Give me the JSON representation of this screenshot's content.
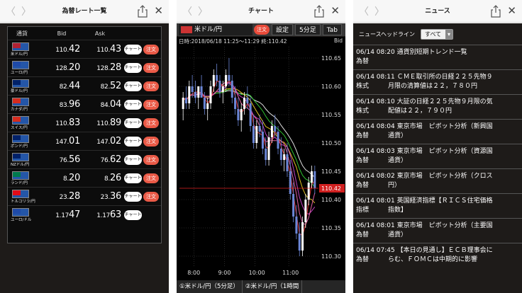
{
  "rates_screen": {
    "title": "為替レート一覧",
    "headers": {
      "currency": "通貨",
      "bid": "Bid",
      "ask": "Ask"
    },
    "chart_label": "チャート",
    "order_label": "注文",
    "rows": [
      {
        "pair": "米ドル/円",
        "bid_main": "110.",
        "bid_big": "42",
        "ask_main": "110.",
        "ask_big": "43",
        "has_order": true,
        "flag": "#b22234"
      },
      {
        "pair": "ユーロ/円",
        "bid_main": "128.",
        "bid_big": "20",
        "ask_main": "128.",
        "ask_big": "28",
        "has_order": true,
        "flag": "#1f4aa8"
      },
      {
        "pair": "豪ドル/円",
        "bid_main": "82.",
        "bid_big": "44",
        "ask_main": "82.",
        "ask_big": "52",
        "has_order": true,
        "flag": "#012169"
      },
      {
        "pair": "カナダ/円",
        "bid_main": "83.",
        "bid_big": "96",
        "ask_main": "84.",
        "ask_big": "04",
        "has_order": true,
        "flag": "#d52b1e"
      },
      {
        "pair": "スイス/円",
        "bid_main": "110.",
        "bid_big": "83",
        "ask_main": "110.",
        "ask_big": "89",
        "has_order": true,
        "flag": "#d52b1e"
      },
      {
        "pair": "ポンド/円",
        "bid_main": "147.",
        "bid_big": "01",
        "ask_main": "147.",
        "ask_big": "02",
        "has_order": true,
        "flag": "#012169"
      },
      {
        "pair": "NZドル/円",
        "bid_main": "76.",
        "bid_big": "56",
        "ask_main": "76.",
        "ask_big": "62",
        "has_order": true,
        "flag": "#012169"
      },
      {
        "pair": "ランド/円",
        "bid_main": "8.",
        "bid_big": "20",
        "ask_main": "8.",
        "ask_big": "26",
        "has_order": true,
        "flag": "#007a4d"
      },
      {
        "pair": "トルコリラ/円",
        "bid_main": "23.",
        "bid_big": "28",
        "ask_main": "23.",
        "ask_big": "36",
        "has_order": true,
        "flag": "#e30a17"
      },
      {
        "pair": "ユーロ/ドル",
        "bid_main": "1.17",
        "bid_big": "47",
        "ask_main": "1.17",
        "ask_big": "63",
        "has_order": false,
        "flag": "#1f4aa8"
      }
    ]
  },
  "chart_screen": {
    "title": "チャート",
    "pair": "米ドル/円",
    "order_label": "注文",
    "settings_label": "設定",
    "timeframe_label": "5分足",
    "tab_label": "Tab",
    "info": "日時:2018/06/18 11:25～11:29 終:110.42",
    "bid_label": "Bid",
    "current_price_label": "110.42",
    "tabs": [
      "①米ドル/円（5分足）",
      "②米ドル/円（1時間"
    ],
    "colors": {
      "up": "#ffffff",
      "down": "#6b86d6",
      "ma_short": "#e03030",
      "ma_mid": "#c040c0",
      "ma_long": "#dddddd",
      "ma_green": "#30c030",
      "ma_yellow": "#e0c020",
      "ma_pink": "#e060a0"
    }
  },
  "chart_data": {
    "type": "candlestick",
    "x_tick_labels": [
      "8:00",
      "9:00",
      "10:00",
      "11:00"
    ],
    "y_tick_labels": [
      "110.65",
      "110.60",
      "110.55",
      "110.50",
      "110.45",
      "110.40",
      "110.35",
      "110.30"
    ],
    "ylim": [
      110.28,
      110.67
    ],
    "current_price": 110.42,
    "candles": [
      [
        110.56,
        110.59,
        110.54,
        110.58
      ],
      [
        110.58,
        110.6,
        110.56,
        110.57
      ],
      [
        110.57,
        110.61,
        110.56,
        110.6
      ],
      [
        110.6,
        110.62,
        110.58,
        110.59
      ],
      [
        110.59,
        110.61,
        110.57,
        110.58
      ],
      [
        110.58,
        110.6,
        110.56,
        110.6
      ],
      [
        110.6,
        110.62,
        110.58,
        110.58
      ],
      [
        110.58,
        110.59,
        110.55,
        110.56
      ],
      [
        110.56,
        110.58,
        110.54,
        110.57
      ],
      [
        110.57,
        110.61,
        110.56,
        110.6
      ],
      [
        110.6,
        110.63,
        110.59,
        110.62
      ],
      [
        110.62,
        110.64,
        110.6,
        110.61
      ],
      [
        110.61,
        110.62,
        110.58,
        110.59
      ],
      [
        110.59,
        110.61,
        110.57,
        110.6
      ],
      [
        110.6,
        110.63,
        110.59,
        110.62
      ],
      [
        110.62,
        110.65,
        110.6,
        110.61
      ],
      [
        110.61,
        110.62,
        110.57,
        110.58
      ],
      [
        110.58,
        110.6,
        110.55,
        110.56
      ],
      [
        110.56,
        110.58,
        110.53,
        110.54
      ],
      [
        110.54,
        110.57,
        110.52,
        110.56
      ],
      [
        110.56,
        110.59,
        110.55,
        110.58
      ],
      [
        110.58,
        110.6,
        110.56,
        110.57
      ],
      [
        110.57,
        110.58,
        110.52,
        110.53
      ],
      [
        110.53,
        110.55,
        110.49,
        110.5
      ],
      [
        110.5,
        110.54,
        110.49,
        110.53
      ],
      [
        110.53,
        110.55,
        110.51,
        110.52
      ],
      [
        110.52,
        110.54,
        110.48,
        110.49
      ],
      [
        110.49,
        110.51,
        110.46,
        110.47
      ],
      [
        110.47,
        110.52,
        110.46,
        110.51
      ],
      [
        110.51,
        110.54,
        110.5,
        110.53
      ],
      [
        110.53,
        110.55,
        110.51,
        110.52
      ],
      [
        110.52,
        110.53,
        110.48,
        110.49
      ],
      [
        110.49,
        110.51,
        110.46,
        110.47
      ],
      [
        110.47,
        110.49,
        110.45,
        110.48
      ],
      [
        110.48,
        110.5,
        110.44,
        110.45
      ],
      [
        110.45,
        110.47,
        110.4,
        110.41
      ],
      [
        110.41,
        110.43,
        110.36,
        110.37
      ],
      [
        110.37,
        110.39,
        110.33,
        110.34
      ],
      [
        110.34,
        110.36,
        110.3,
        110.31
      ],
      [
        110.31,
        110.37,
        110.3,
        110.36
      ],
      [
        110.36,
        110.41,
        110.35,
        110.4
      ],
      [
        110.4,
        110.44,
        110.39,
        110.43
      ],
      [
        110.43,
        110.46,
        110.42,
        110.45
      ],
      [
        110.45,
        110.46,
        110.41,
        110.42
      ]
    ]
  },
  "news_screen": {
    "title": "ニュース",
    "header_label": "ニュースヘッドライン",
    "filter_label": "すべて",
    "items": [
      {
        "time": "06/14 08:20",
        "title": "通貨別短期トレンド一覧",
        "category": "為替"
      },
      {
        "time": "06/14 08:11",
        "title": "ＣＭＥ取引所の日経２２５先物９",
        "category": "株式",
        "title2": "月限の清算値は２２，７８０円"
      },
      {
        "time": "06/14 08:10",
        "title": "大証の日経２２５先物９月限の気",
        "category": "株式",
        "title2": "配値は２２，７９０円"
      },
      {
        "time": "06/14 08:04",
        "title": "東京市場　ピボット分析（新興国",
        "category": "為替",
        "title2": "通貨）"
      },
      {
        "time": "06/14 08:03",
        "title": "東京市場　ピボット分析（資源国",
        "category": "為替",
        "title2": "通貨）"
      },
      {
        "time": "06/14 08:02",
        "title": "東京市場　ピボット分析（クロス",
        "category": "為替",
        "title2": "円）"
      },
      {
        "time": "06/14 08:01",
        "title": "英国経済指標【ＲＩＣＳ住宅価格",
        "category": "指標",
        "title2": "指数】"
      },
      {
        "time": "06/14 08:01",
        "title": "東京市場　ピボット分析（主要国",
        "category": "為替",
        "title2": "通貨）"
      },
      {
        "time": "06/14 07:45",
        "title": "【本日の見通し】ＥＣＢ理事会に",
        "category": "為替",
        "title2": "らむ、ＦＯＭＣは中期的に影響"
      }
    ]
  }
}
